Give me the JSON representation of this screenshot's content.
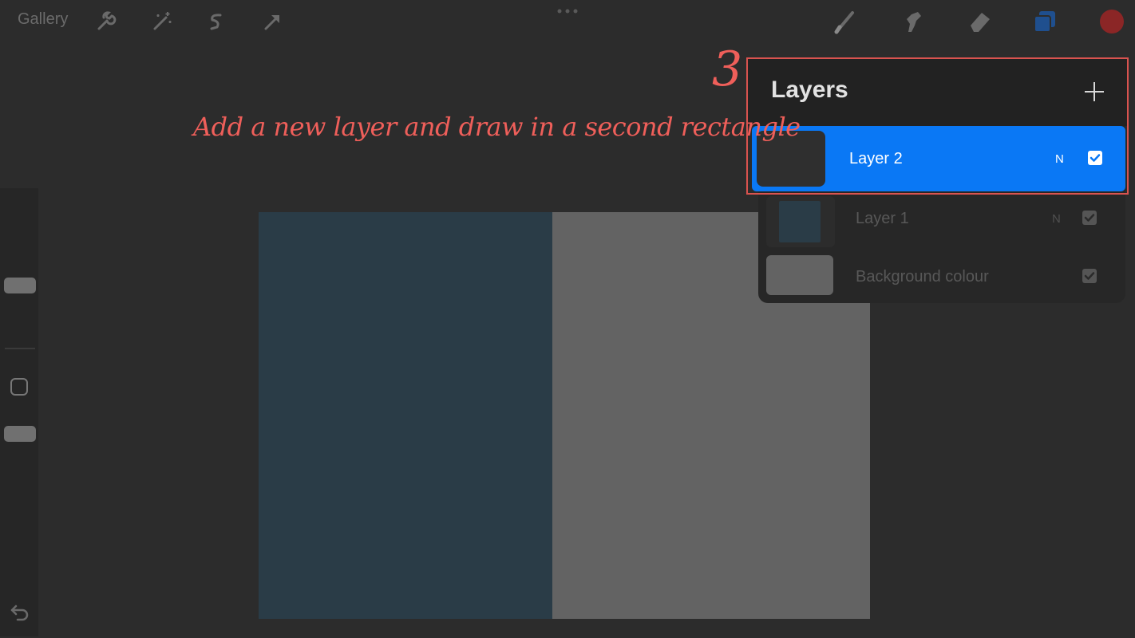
{
  "toolbar": {
    "gallery_label": "Gallery",
    "left_tools": [
      "wrench-icon",
      "magic-wand-icon",
      "selection-icon",
      "transform-arrow-icon"
    ],
    "right_tools": [
      "brush-icon",
      "smudge-icon",
      "eraser-icon",
      "layers-icon",
      "color-swatch"
    ],
    "layers_icon_color": "#1f4f8e",
    "color_swatch_color": "#8b2626"
  },
  "canvas": {
    "background_color": "#636363",
    "rectangle_color": "#2a3c47"
  },
  "layers_panel": {
    "title": "Layers",
    "add_icon": "plus-icon",
    "layers": [
      {
        "name": "Layer 2",
        "blend_mode": "N",
        "visible": true,
        "selected": true
      },
      {
        "name": "Layer 1",
        "blend_mode": "N",
        "visible": true,
        "selected": false
      },
      {
        "name": "Background colour",
        "blend_mode": "",
        "visible": true,
        "selected": false
      }
    ],
    "selected_color": "#0a78f5"
  },
  "annotation": {
    "step": "3",
    "instruction": "Add a new layer and draw in a second rectangle",
    "color": "#ef5f5a"
  }
}
